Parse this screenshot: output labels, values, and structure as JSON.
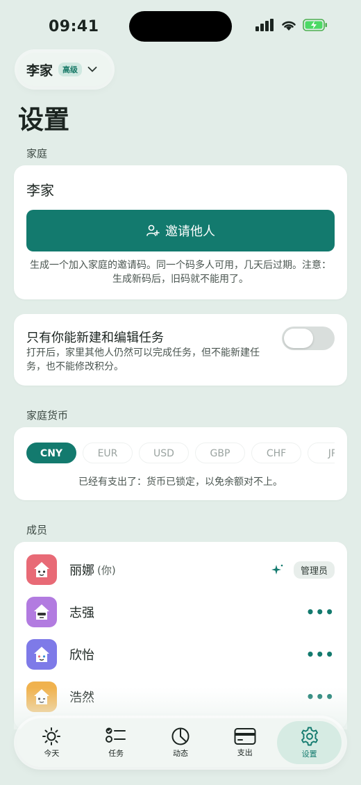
{
  "status": {
    "time": "09:41"
  },
  "family_switcher": {
    "name": "李家",
    "badge": "高级"
  },
  "page_title": "设置",
  "family_section": {
    "label": "家庭",
    "family_name": "李家",
    "invite_label": "邀请他人",
    "invite_note": "生成一个加入家庭的邀请码。同一个码多人可用，几天后过期。注意：生成新码后，旧码就不能用了。"
  },
  "permission": {
    "title": "只有你能新建和编辑任务",
    "description": "打开后，家里其他人仍然可以完成任务，但不能新建任务，也不能修改积分。",
    "enabled": false
  },
  "currency_section": {
    "label": "家庭货币",
    "options": [
      "CNY",
      "EUR",
      "USD",
      "GBP",
      "CHF",
      "JP"
    ],
    "selected": "CNY",
    "note": "已经有支出了：货币已锁定，以免余额对不上。"
  },
  "members_section": {
    "label": "成员",
    "members": [
      {
        "name": "丽娜",
        "you": "(你)",
        "badge": "管理员",
        "color": "#e86a76",
        "icon": "house-face-icon"
      },
      {
        "name": "志强",
        "color": "#b27be0",
        "icon": "house-face-icon"
      },
      {
        "name": "欣怡",
        "color": "#7e7ae8",
        "icon": "house-face-icon"
      },
      {
        "name": "浩然",
        "color": "#f0b24e",
        "icon": "house-face-icon"
      }
    ],
    "more_glyph": "•••"
  },
  "tabbar": {
    "tabs": [
      {
        "label": "今天",
        "icon": "sun-icon"
      },
      {
        "label": "任务",
        "icon": "checklist-icon"
      },
      {
        "label": "动态",
        "icon": "pie-chart-icon"
      },
      {
        "label": "支出",
        "icon": "card-icon"
      },
      {
        "label": "设置",
        "icon": "gear-icon"
      }
    ],
    "active": "设置"
  },
  "colors": {
    "accent": "#137a6e",
    "background": "#e2ede8"
  }
}
